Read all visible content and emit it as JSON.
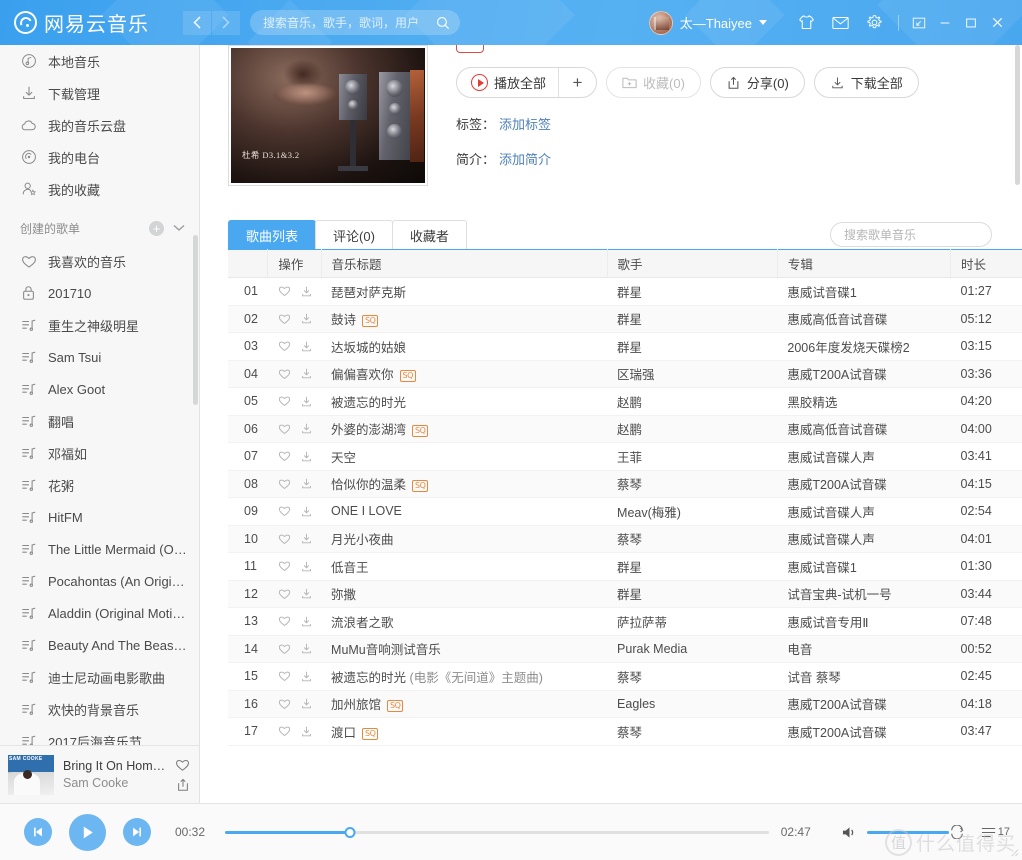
{
  "titlebar": {
    "brand": "网易云音乐",
    "nav": {
      "back": "‹",
      "forward": "›"
    },
    "search": {
      "placeholder": "搜索音乐，歌手，歌词，用户",
      "value": ""
    },
    "user": {
      "name": "太—Thaiyee"
    },
    "icons": {
      "shirt": "shirt-icon",
      "mail": "mail-icon",
      "gear": "gear-icon"
    },
    "window": {
      "mini_mode": "⤢",
      "minimize": "—",
      "maximize": "□",
      "close": "✕"
    }
  },
  "sidebar": {
    "nav_items": [
      {
        "label": "本地音乐",
        "icon": "music-note-circle-icon"
      },
      {
        "label": "下载管理",
        "icon": "download-icon"
      },
      {
        "label": "我的音乐云盘",
        "icon": "cloud-icon"
      },
      {
        "label": "我的电台",
        "icon": "radio-icon"
      },
      {
        "label": "我的收藏",
        "icon": "user-star-icon"
      }
    ],
    "group_title": "创建的歌单",
    "playlists": [
      {
        "label": "我喜欢的音乐",
        "icon": "heart-icon"
      },
      {
        "label": "201710",
        "icon": "lock-icon"
      },
      {
        "label": "重生之神级明星",
        "icon": "playlist-icon"
      },
      {
        "label": "Sam Tsui",
        "icon": "playlist-icon"
      },
      {
        "label": "Alex Goot",
        "icon": "playlist-icon"
      },
      {
        "label": "翻唱",
        "icon": "playlist-icon"
      },
      {
        "label": "邓福如",
        "icon": "playlist-icon"
      },
      {
        "label": "花粥",
        "icon": "playlist-icon"
      },
      {
        "label": "HitFM",
        "icon": "playlist-icon"
      },
      {
        "label": "The Little Mermaid (Orig…",
        "icon": "playlist-icon"
      },
      {
        "label": "Pocahontas (An Origina…",
        "icon": "playlist-icon"
      },
      {
        "label": "Aladdin (Original Motion…",
        "icon": "playlist-icon"
      },
      {
        "label": "Beauty And The Beast (…",
        "icon": "playlist-icon"
      },
      {
        "label": "迪士尼动画电影歌曲",
        "icon": "playlist-icon"
      },
      {
        "label": "欢快的背景音乐",
        "icon": "playlist-icon"
      },
      {
        "label": "2017后海音乐节",
        "icon": "playlist-icon"
      }
    ],
    "now_playing": {
      "title": "Bring It On Home …",
      "artist": "Sam Cooke"
    }
  },
  "playlist_header": {
    "cover_caption": "杜希 D3.1&3.2",
    "buttons": {
      "play_all": "播放全部",
      "add": "+",
      "collect": "收藏(0)",
      "share": "分享(0)",
      "download_all": "下载全部"
    },
    "tags_key": "标签：",
    "tags_value": "添加标签",
    "desc_key": "简介：",
    "desc_value": "添加简介"
  },
  "tabs": [
    {
      "label": "歌曲列表",
      "active": true
    },
    {
      "label": "评论(0)",
      "active": false
    },
    {
      "label": "收藏者",
      "active": false
    }
  ],
  "list_search": {
    "placeholder": "搜索歌单音乐",
    "value": ""
  },
  "table": {
    "columns": [
      "",
      "操作",
      "音乐标题",
      "歌手",
      "专辑",
      "时长"
    ],
    "rows": [
      {
        "index": "01",
        "title": "琵琶对萨克斯",
        "sq": false,
        "artist": "群星",
        "album": "惠威试音碟1",
        "duration": "01:27"
      },
      {
        "index": "02",
        "title": "鼓诗",
        "sq": true,
        "artist": "群星",
        "album": "惠威高低音试音碟",
        "duration": "05:12"
      },
      {
        "index": "03",
        "title": "达坂城的姑娘",
        "sq": false,
        "artist": "群星",
        "album": "2006年度发烧天碟榜2",
        "duration": "03:15"
      },
      {
        "index": "04",
        "title": "偏偏喜欢你",
        "sq": true,
        "artist": "区瑞强",
        "album": "惠威T200A试音碟",
        "duration": "03:36"
      },
      {
        "index": "05",
        "title": "被遗忘的时光",
        "sq": false,
        "artist": "赵鹏",
        "album": "黑胶精选",
        "duration": "04:20"
      },
      {
        "index": "06",
        "title": "外婆的澎湖湾",
        "sq": true,
        "artist": "赵鹏",
        "album": "惠威高低音试音碟",
        "duration": "04:00"
      },
      {
        "index": "07",
        "title": "天空",
        "sq": false,
        "artist": "王菲",
        "album": "惠威试音碟人声",
        "duration": "03:41"
      },
      {
        "index": "08",
        "title": "恰似你的温柔",
        "sq": true,
        "artist": "蔡琴",
        "album": "惠威T200A试音碟",
        "duration": "04:15"
      },
      {
        "index": "09",
        "title": "ONE I LOVE",
        "sq": false,
        "artist": "Meav(梅雅)",
        "album": "惠威试音碟人声",
        "duration": "02:54"
      },
      {
        "index": "10",
        "title": "月光小夜曲",
        "sq": false,
        "artist": "蔡琴",
        "album": "惠威试音碟人声",
        "duration": "04:01"
      },
      {
        "index": "11",
        "title": "低音王",
        "sq": false,
        "artist": "群星",
        "album": "惠威试音碟1",
        "duration": "01:30"
      },
      {
        "index": "12",
        "title": "弥撒",
        "sq": false,
        "artist": "群星",
        "album": "试音宝典-试机一号",
        "duration": "03:44"
      },
      {
        "index": "13",
        "title": "流浪者之歌",
        "sq": false,
        "artist": "萨拉萨蒂",
        "album": "惠威试音专用Ⅱ",
        "duration": "07:48"
      },
      {
        "index": "14",
        "title": "MuMu音响测试音乐",
        "sq": false,
        "artist": "Purak Media",
        "album": "电音",
        "duration": "00:52"
      },
      {
        "index": "15",
        "title": "被遗忘的时光",
        "subtitle": "(电影《无间道》主题曲)",
        "sq": false,
        "artist": "蔡琴",
        "album": "试音 蔡琴",
        "duration": "02:45"
      },
      {
        "index": "16",
        "title": "加州旅馆",
        "sq": true,
        "artist": "Eagles",
        "album": "惠威T200A试音碟",
        "duration": "04:18"
      },
      {
        "index": "17",
        "title": "渡口",
        "sq": true,
        "artist": "蔡琴",
        "album": "惠威T200A试音碟",
        "duration": "03:47"
      }
    ]
  },
  "player": {
    "current_time": "00:32",
    "total_time": "02:47",
    "progress_percent": 23,
    "volume_percent": 100,
    "queue_count": "17",
    "icons": {
      "prev": "previous-icon",
      "play": "play-icon",
      "next": "next-icon",
      "volume": "volume-icon"
    }
  },
  "watermark": {
    "mark": "值",
    "text": "什么值得买"
  },
  "colors": {
    "accent": "#4aa8f0",
    "play_red": "#e63a34",
    "sq_orange": "#e8883c",
    "link": "#4e81b8"
  }
}
